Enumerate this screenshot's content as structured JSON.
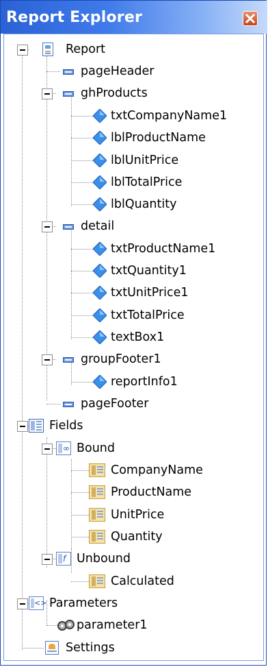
{
  "window": {
    "title": "Report Explorer"
  },
  "tree": {
    "report": "Report",
    "pageHeader": "pageHeader",
    "ghProducts": "ghProducts",
    "ghProducts_items": [
      "txtCompanyName1",
      "lblProductName",
      "lblUnitPrice",
      "lblTotalPrice",
      "lblQuantity"
    ],
    "detail": "detail",
    "detail_items": [
      "txtProductName1",
      "txtQuantity1",
      "txtUnitPrice1",
      "txtTotalPrice",
      "textBox1"
    ],
    "groupFooter1": "groupFooter1",
    "groupFooter1_items": [
      "reportInfo1"
    ],
    "pageFooter": "pageFooter",
    "fields": "Fields",
    "bound": "Bound",
    "bound_items": [
      "CompanyName",
      "ProductName",
      "UnitPrice",
      "Quantity"
    ],
    "unbound": "Unbound",
    "unbound_items": [
      "Calculated"
    ],
    "parameters": "Parameters",
    "parameters_items": [
      "parameter1"
    ],
    "settings": "Settings"
  },
  "colors": {
    "title_gradient_start": "#2a62d6",
    "title_gradient_end": "#c5dafb",
    "close_button": "#c9431d",
    "control_diamond": "#3a8fe8"
  }
}
